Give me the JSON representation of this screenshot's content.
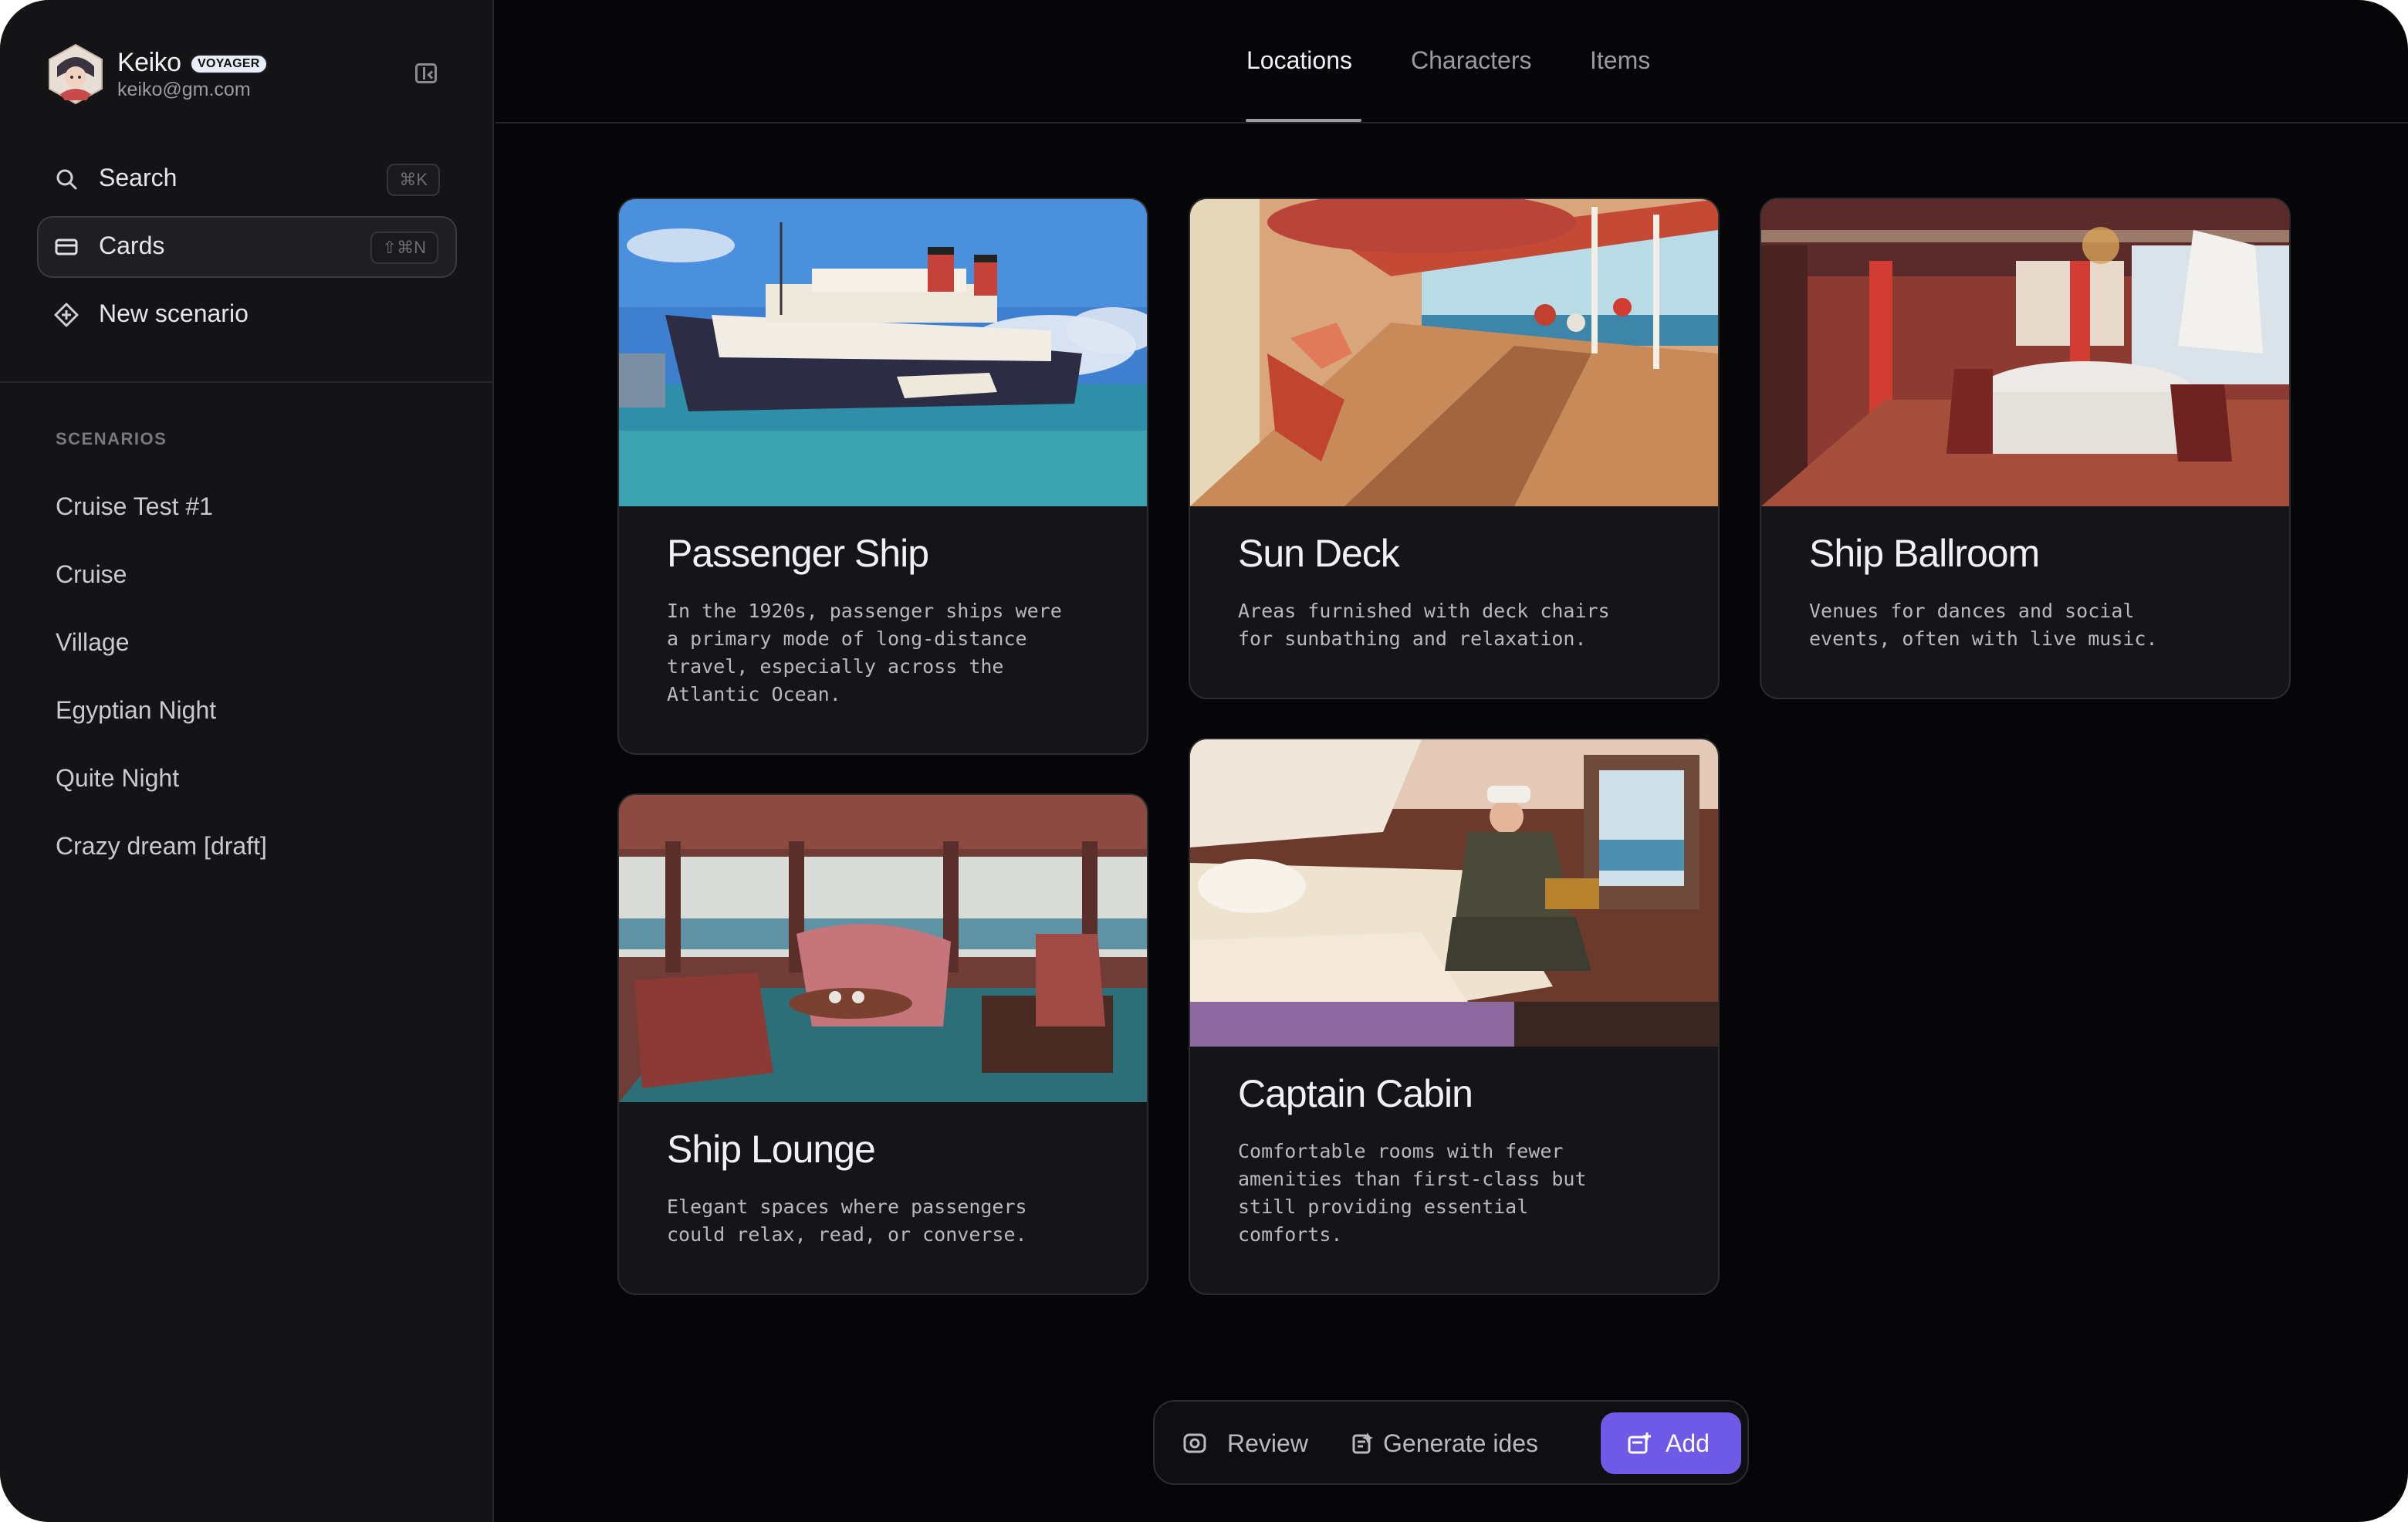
{
  "profile": {
    "name": "Keiko",
    "badge": "VOYAGER",
    "email": "keiko@gm.com"
  },
  "nav": [
    {
      "label": "Search",
      "icon": "search-icon",
      "shortcut": "⌘K"
    },
    {
      "label": "Cards",
      "icon": "card-icon",
      "shortcut": "⇧⌘N",
      "active": true
    },
    {
      "label": "New scenario",
      "icon": "diamond-plus-icon"
    }
  ],
  "scenarios": {
    "title": "SCENARIOS",
    "items": [
      "Cruise Test #1",
      "Cruise",
      "Village",
      "Egyptian Night",
      "Quite Night",
      "Crazy dream [draft]"
    ]
  },
  "tabs": [
    {
      "label": "Locations",
      "active": true
    },
    {
      "label": "Characters"
    },
    {
      "label": "Items"
    }
  ],
  "cards": [
    {
      "title": "Passenger Ship",
      "description": "In the 1920s, passenger ships were\na primary mode of long-distance\ntravel, especially across the\nAtlantic Ocean."
    },
    {
      "title": "Sun Deck",
      "description": "Areas furnished with deck chairs\nfor sunbathing and relaxation."
    },
    {
      "title": "Ship Ballroom",
      "description": "Venues for dances and social\nevents, often with live music."
    },
    {
      "title": "Ship Lounge",
      "description": "Elegant spaces where passengers\ncould relax, read, or converse."
    },
    {
      "title": "Captain Cabin",
      "description": "Comfortable rooms with fewer\namenities than first-class but\nstill providing essential\ncomforts."
    }
  ],
  "toolbar": {
    "review_label": "Review",
    "generate_label": "Generate ides",
    "add_label": "Add"
  },
  "colors": {
    "accent": "#6e5ae6",
    "background": "#060608",
    "sidebar": "#141416",
    "card": "#151518"
  }
}
